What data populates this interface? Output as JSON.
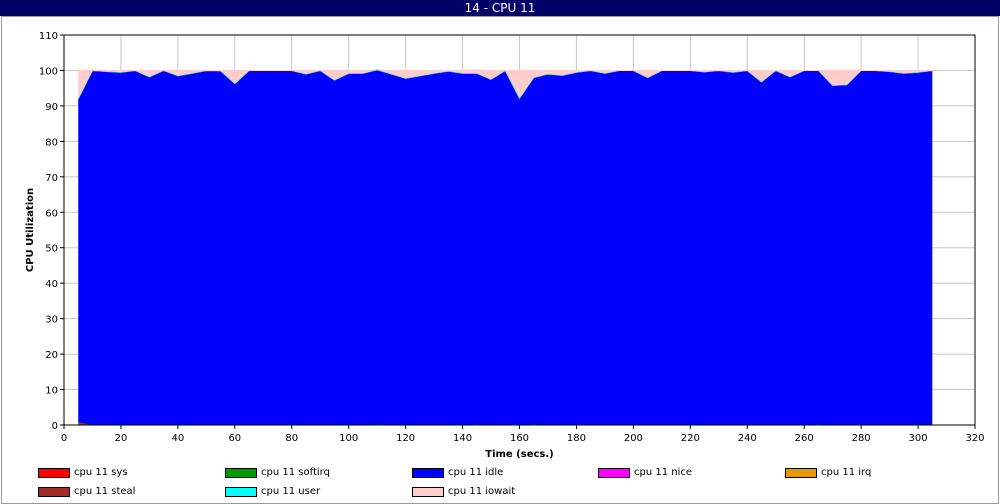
{
  "window": {
    "title": "14 - CPU 11"
  },
  "chart_data": {
    "type": "area",
    "title": "14 - CPU 11",
    "xlabel": "Time (secs.)",
    "ylabel": "CPU Utilization",
    "xlim": [
      0,
      320
    ],
    "ylim": [
      0,
      110
    ],
    "x_ticks": [
      0,
      20,
      40,
      60,
      80,
      100,
      120,
      140,
      160,
      180,
      200,
      220,
      240,
      260,
      280,
      300,
      320
    ],
    "y_ticks": [
      0,
      10,
      20,
      30,
      40,
      50,
      60,
      70,
      80,
      90,
      100,
      110
    ],
    "grid": true,
    "stacked": true,
    "x": [
      5,
      10,
      15,
      20,
      25,
      30,
      35,
      40,
      45,
      50,
      55,
      60,
      65,
      70,
      75,
      80,
      85,
      90,
      95,
      100,
      105,
      110,
      115,
      120,
      125,
      130,
      135,
      140,
      145,
      150,
      155,
      160,
      165,
      170,
      175,
      180,
      185,
      190,
      195,
      200,
      205,
      210,
      215,
      220,
      225,
      230,
      235,
      240,
      245,
      250,
      255,
      260,
      265,
      270,
      275,
      280,
      285,
      290,
      295,
      300,
      305
    ],
    "series": [
      {
        "name": "cpu 11 sys",
        "color": "#ff0000",
        "values": [
          0.5,
          0,
          0,
          0,
          0,
          0,
          0,
          0,
          0,
          0,
          0,
          0,
          0,
          0,
          0,
          0,
          0,
          0,
          0,
          0,
          0,
          0,
          0,
          0,
          0,
          0,
          0,
          0,
          0,
          0,
          0,
          0,
          0,
          0,
          0,
          0,
          0,
          0,
          0,
          0,
          0,
          0,
          0,
          0,
          0,
          0,
          0,
          0,
          0,
          0,
          0,
          0,
          0,
          0,
          0,
          0,
          0,
          0,
          0,
          0,
          0
        ]
      },
      {
        "name": "cpu 11 softirq",
        "color": "#009900",
        "values": [
          0.3,
          0,
          0,
          0,
          0,
          0,
          0,
          0,
          0,
          0,
          0,
          0,
          0,
          0,
          0,
          0.2,
          0,
          0,
          0,
          0,
          0,
          0.2,
          0,
          0,
          0,
          0,
          0,
          0,
          0.2,
          0,
          0,
          0,
          0.2,
          0,
          0,
          0,
          0,
          0,
          0,
          0,
          0,
          0,
          0,
          0,
          0,
          0,
          0,
          0,
          0,
          0,
          0,
          0,
          0.2,
          0,
          0,
          0,
          0,
          0,
          0,
          0.2,
          0
        ]
      },
      {
        "name": "cpu 11 idle",
        "color": "#0000ff",
        "values": [
          91.2,
          100,
          99.7,
          99.5,
          100,
          98.2,
          100,
          98.5,
          99.2,
          100,
          99.9,
          96.3,
          100,
          100,
          100,
          99.8,
          99,
          100,
          97.3,
          99.2,
          99.2,
          100,
          99,
          97.8,
          98.5,
          99.2,
          99.8,
          99.2,
          99,
          97.5,
          100,
          92.2,
          97.8,
          99,
          98.6,
          99.5,
          100,
          99.2,
          100,
          100,
          98,
          100,
          100,
          100,
          99.6,
          100,
          99.5,
          100,
          96.8,
          100,
          98.2,
          100,
          99.8,
          95.8,
          96,
          100,
          100,
          99.7,
          99.2,
          99.3,
          100
        ]
      },
      {
        "name": "cpu 11 nice",
        "color": "#ff00ff",
        "values": [
          0,
          0,
          0,
          0,
          0,
          0,
          0,
          0,
          0,
          0,
          0,
          0,
          0,
          0,
          0,
          0,
          0,
          0,
          0,
          0,
          0,
          0,
          0,
          0,
          0,
          0,
          0,
          0,
          0,
          0,
          0,
          0,
          0,
          0,
          0,
          0,
          0,
          0,
          0,
          0,
          0,
          0,
          0,
          0,
          0,
          0,
          0,
          0,
          0,
          0,
          0,
          0,
          0,
          0,
          0,
          0,
          0,
          0,
          0,
          0,
          0
        ]
      },
      {
        "name": "cpu 11 irq",
        "color": "#e69900",
        "values": [
          0,
          0,
          0,
          0,
          0,
          0,
          0,
          0,
          0,
          0,
          0,
          0,
          0,
          0,
          0,
          0,
          0,
          0,
          0,
          0,
          0,
          0,
          0,
          0,
          0,
          0,
          0,
          0,
          0,
          0,
          0,
          0,
          0,
          0,
          0,
          0,
          0,
          0,
          0,
          0,
          0,
          0,
          0,
          0,
          0,
          0,
          0,
          0,
          0,
          0,
          0,
          0,
          0,
          0,
          0,
          0,
          0,
          0,
          0,
          0,
          0
        ]
      },
      {
        "name": "cpu 11 steal",
        "color": "#a52a2a",
        "values": [
          0,
          0,
          0,
          0,
          0,
          0,
          0,
          0,
          0,
          0,
          0,
          0,
          0,
          0,
          0,
          0,
          0,
          0,
          0,
          0,
          0,
          0,
          0,
          0,
          0,
          0,
          0,
          0,
          0,
          0,
          0,
          0,
          0,
          0,
          0,
          0,
          0,
          0,
          0,
          0,
          0,
          0,
          0,
          0,
          0,
          0,
          0,
          0,
          0,
          0,
          0,
          0,
          0,
          0,
          0,
          0,
          0,
          0,
          0,
          0,
          0
        ]
      },
      {
        "name": "cpu 11 user",
        "color": "#00ffff",
        "values": [
          0,
          0,
          0,
          0,
          0,
          0,
          0,
          0,
          0,
          0,
          0,
          0,
          0,
          0,
          0,
          0,
          0,
          0,
          0,
          0,
          0,
          0,
          0,
          0,
          0,
          0,
          0,
          0,
          0,
          0,
          0,
          0,
          0,
          0,
          0,
          0,
          0,
          0,
          0,
          0,
          0,
          0,
          0,
          0,
          0,
          0,
          0,
          0,
          0,
          0,
          0,
          0,
          0,
          0,
          0,
          0,
          0,
          0,
          0,
          0,
          0
        ]
      },
      {
        "name": "cpu 11 iowait",
        "color": "#ffcccc",
        "values": [
          8,
          0,
          0.3,
          0.5,
          0,
          1.8,
          0,
          1.5,
          0.8,
          0,
          0.1,
          3.7,
          0,
          0,
          0,
          0,
          1,
          0,
          2.7,
          0.8,
          0.8,
          0,
          1,
          2.2,
          1.5,
          0.8,
          0.2,
          0.8,
          1,
          2.5,
          0,
          7.8,
          2,
          1,
          1.4,
          0.5,
          0,
          0.8,
          0,
          0,
          2,
          0,
          0,
          0,
          0.4,
          0,
          0.5,
          0,
          3.2,
          0,
          1.8,
          0,
          0,
          4.2,
          4,
          0,
          0,
          0.3,
          0.8,
          0.5,
          0
        ]
      }
    ]
  }
}
